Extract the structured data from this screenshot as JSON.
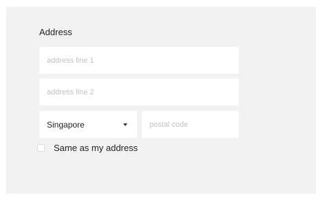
{
  "address": {
    "title": "Address",
    "line1": {
      "value": "",
      "placeholder": "address line 1"
    },
    "line2": {
      "value": "",
      "placeholder": "address line 2"
    },
    "country": {
      "selected": "Singapore",
      "icon": "caret-down-icon"
    },
    "postal": {
      "value": "",
      "placeholder": "postal code"
    },
    "same_as_mine": {
      "label": "Same as my address",
      "checked": false
    }
  }
}
